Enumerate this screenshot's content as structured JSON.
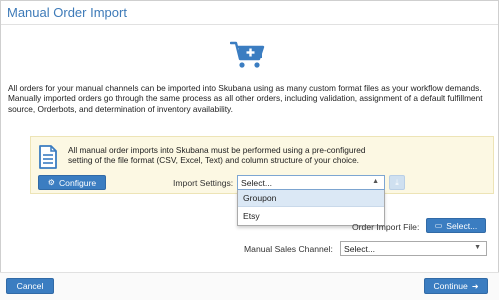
{
  "dialog": {
    "title": "Manual Order Import",
    "intro_text": "All orders for your manual channels can be imported into Skubana using as many custom format files as your workflow demands. Manually imported orders go through the same process as all other orders, including validation, assignment of a default fulfillment source, Orderbots, and determination of inventory availability."
  },
  "notice": {
    "text": "All manual order imports into Skubana must be performed using a pre-configured setting of the file format (CSV, Excel, Text) and column structure of your choice.",
    "configure_label": "Configure"
  },
  "import_settings": {
    "label": "Import Settings:",
    "value": "Select...",
    "options": [
      "Groupon",
      "Etsy"
    ],
    "highlighted_index": 0
  },
  "order_file": {
    "label": "Order Import File:",
    "button_label": "Select..."
  },
  "sales_channel": {
    "label": "Manual Sales Channel:",
    "value": "Select..."
  },
  "footer": {
    "cancel_label": "Cancel",
    "continue_label": "Continue"
  },
  "icons": {
    "cart": "add-to-cart-icon",
    "document": "document-icon",
    "configure": "gear-icon",
    "upload": "upload-icon",
    "folder": "folder-icon",
    "continue": "arrow-right-circle-icon",
    "caret": "caret-down-icon"
  },
  "colors": {
    "accent": "#3b7dc1",
    "title": "#3d7ab8",
    "notice_bg": "#fcf8e3",
    "highlight": "#dbe8f5"
  }
}
